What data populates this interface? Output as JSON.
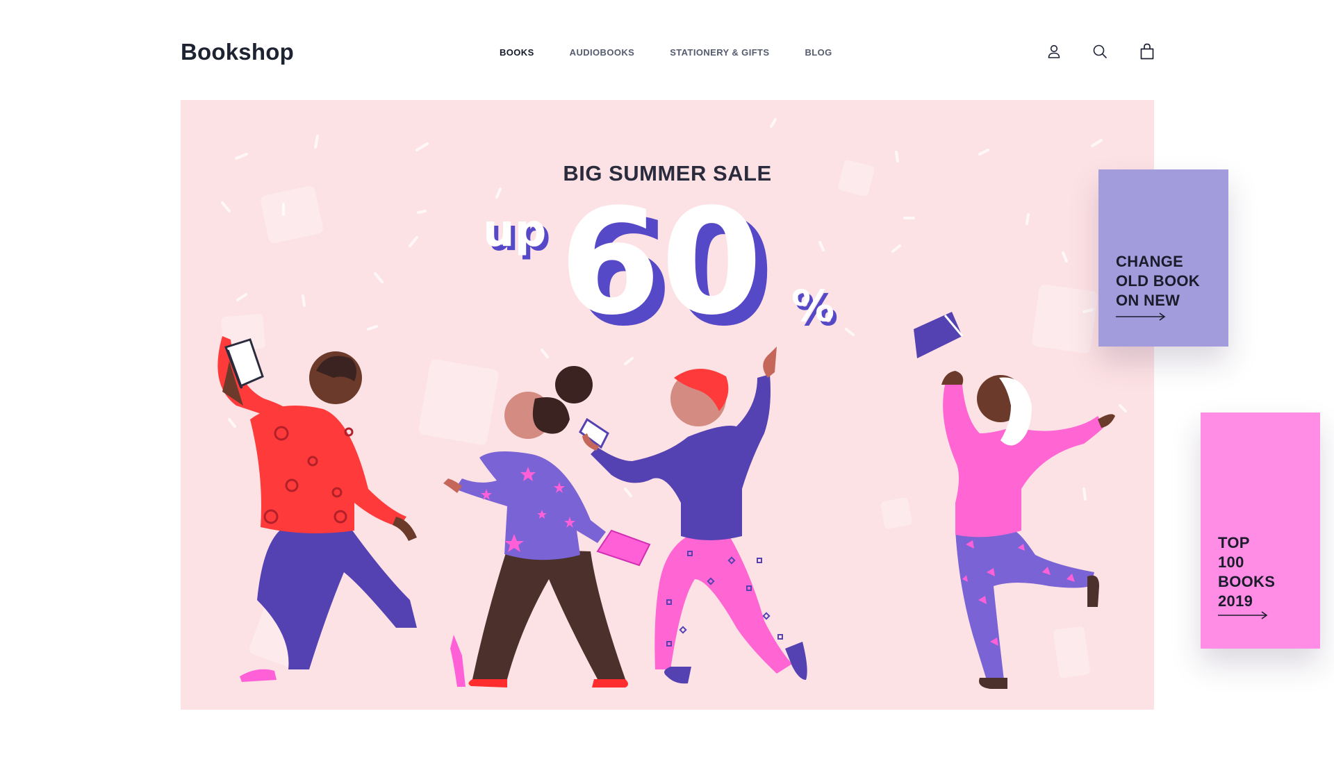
{
  "header": {
    "logo": "Bookshop",
    "nav": [
      {
        "label": "BOOKS",
        "active": true
      },
      {
        "label": "AUDIOBOOKS",
        "active": false
      },
      {
        "label": "STATIONERY & GIFTS",
        "active": false
      },
      {
        "label": "BLOG",
        "active": false
      }
    ],
    "icons": [
      "user-icon",
      "search-icon",
      "shopping-bag-icon"
    ]
  },
  "hero": {
    "heading": "BIG SUMMER SALE",
    "prefix": "up",
    "number": "60",
    "percent": "%",
    "background": "#fde2e5",
    "accent": "#5549c8"
  },
  "promos": [
    {
      "label": "CHANGE\nOLD BOOK\nON NEW",
      "color": "#a29bdc"
    },
    {
      "label": "TOP\n100\nBOOKS\n2019",
      "color": "#ff8de6"
    }
  ]
}
